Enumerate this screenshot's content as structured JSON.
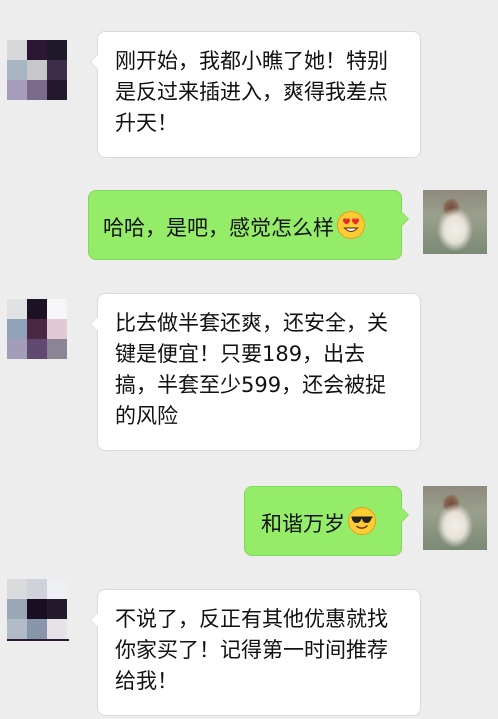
{
  "chat": {
    "messages": [
      {
        "side": "left",
        "text": "刚开始，我都小瞧了她！特别是反过来插进入，爽得我差点升天！"
      },
      {
        "side": "right",
        "text": "哈哈，是吧，感觉怎么样",
        "emoji": "heart-eyes-emoji"
      },
      {
        "side": "left",
        "text": "比去做半套还爽，还安全，关键是便宜！只要189，出去搞，半套至少599，还会被捉的风险"
      },
      {
        "side": "right",
        "text": "和谐万岁",
        "emoji": "sunglasses-emoji"
      },
      {
        "side": "left",
        "text": "不说了，反正有其他优惠就找你家买了！记得第一时间推荐给我！"
      }
    ]
  },
  "colors": {
    "background": "#ededed",
    "bubble_left": "#ffffff",
    "bubble_right": "#95ec69"
  }
}
